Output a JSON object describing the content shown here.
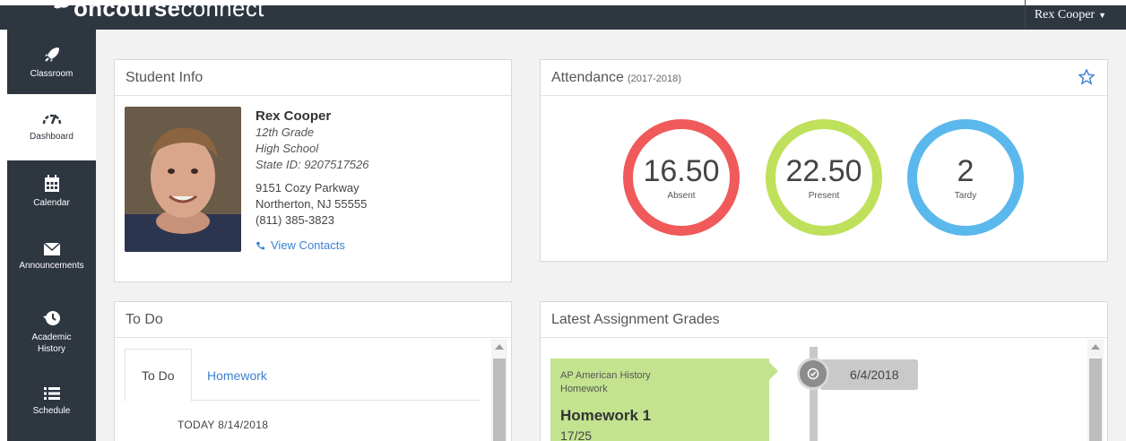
{
  "app": {
    "brand_bold": "oncourse",
    "brand_light": "connect",
    "user_name": "Rex Cooper"
  },
  "sidebar": {
    "items": [
      {
        "label": "Classroom",
        "icon": "rocket-icon"
      },
      {
        "label": "Dashboard",
        "icon": "gauge-icon",
        "active": true
      },
      {
        "label": "Calendar",
        "icon": "calendar-icon"
      },
      {
        "label": "Announcements",
        "icon": "envelope-icon"
      },
      {
        "label": "Academic History",
        "icon": "history-icon"
      },
      {
        "label": "Schedule",
        "icon": "list-icon"
      }
    ]
  },
  "student_info": {
    "title": "Student Info",
    "name": "Rex Cooper",
    "grade": "12th Grade",
    "school": "High School",
    "state_id": "State ID: 9207517526",
    "address_line1": "9151 Cozy Parkway",
    "address_line2": "Northerton, NJ 55555",
    "phone": "(811) 385-3823",
    "contacts_link": "View Contacts"
  },
  "attendance": {
    "title": "Attendance",
    "year": "(2017-2018)",
    "stats": [
      {
        "value": "16.50",
        "label": "Absent",
        "color": "#f05a5a"
      },
      {
        "value": "22.50",
        "label": "Present",
        "color": "#bfe05a"
      },
      {
        "value": "2",
        "label": "Tardy",
        "color": "#5bb8ec"
      }
    ]
  },
  "todo": {
    "title": "To Do",
    "tabs": [
      "To Do",
      "Homework"
    ],
    "today": "TODAY 8/14/2018"
  },
  "latest_grades": {
    "title": "Latest Assignment Grades",
    "course": "AP American History",
    "category": "Homework",
    "assignment": "Homework 1",
    "score": "17/25",
    "date": "6/4/2018"
  },
  "colors": {
    "nav_bg": "#2e3640",
    "link": "#3b82d0",
    "card_green": "#c3e38f"
  }
}
